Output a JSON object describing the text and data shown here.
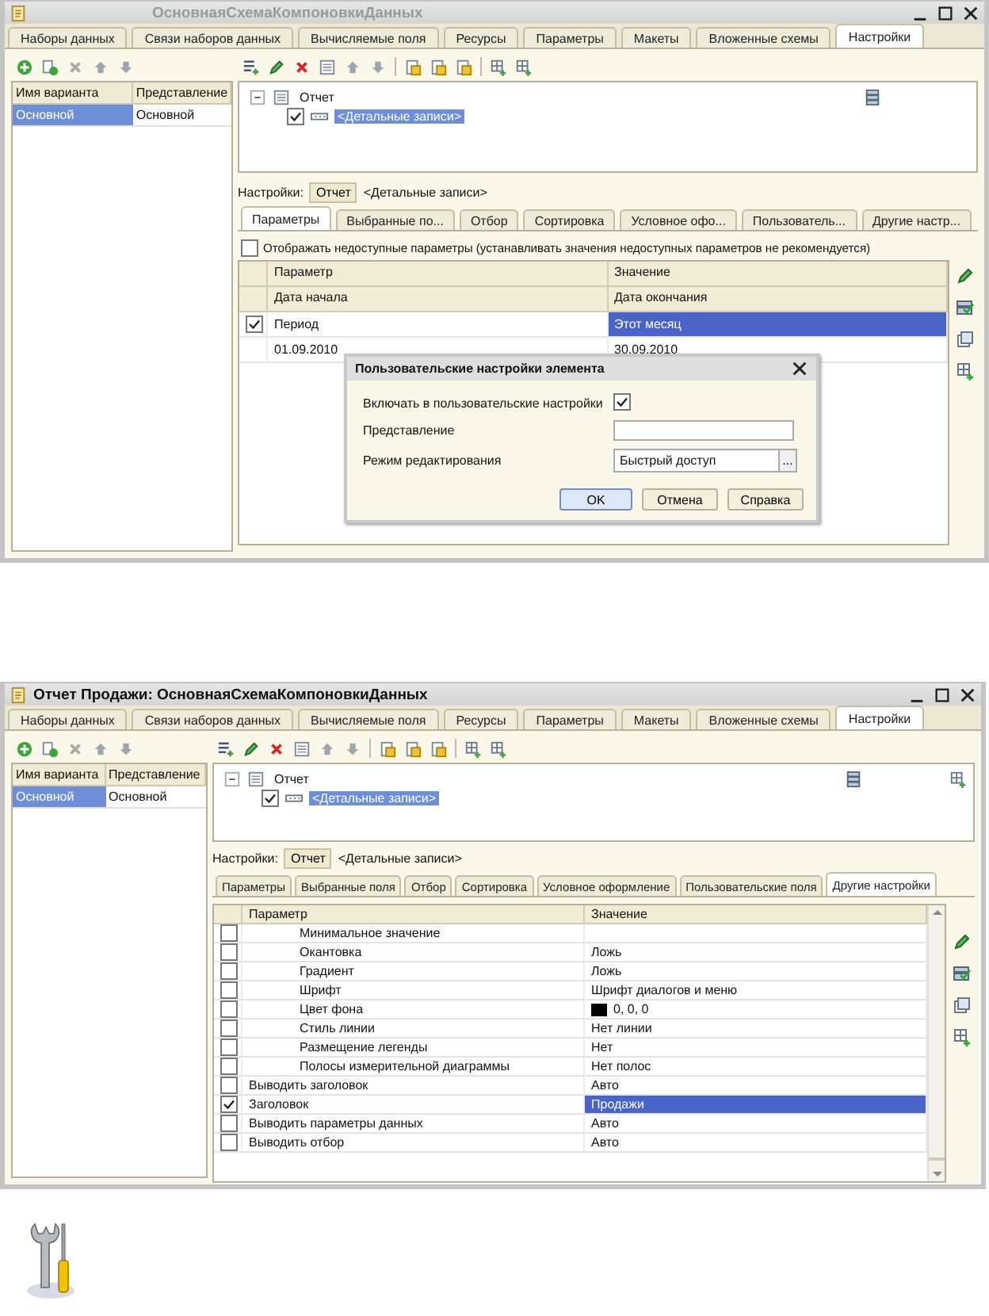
{
  "windows": [
    {
      "title": "ОсновнаяСхемаКомпоновкиДанных",
      "active": false,
      "tabs": [
        {
          "label": "Наборы данных",
          "selected": false
        },
        {
          "label": "Связи наборов данных",
          "selected": false
        },
        {
          "label": "Вычисляемые поля",
          "selected": false
        },
        {
          "label": "Ресурсы",
          "selected": false
        },
        {
          "label": "Параметры",
          "selected": false
        },
        {
          "label": "Макеты",
          "selected": false
        },
        {
          "label": "Вложенные схемы",
          "selected": false
        },
        {
          "label": "Настройки",
          "selected": true
        }
      ],
      "variants": {
        "columns": [
          "Имя варианта",
          "Представление"
        ],
        "rows": [
          {
            "cells": [
              "Основной",
              "Основной"
            ],
            "selected": true
          }
        ]
      },
      "tree": {
        "label": "Отчет",
        "expanded": true,
        "children": [
          {
            "label": "<Детальные записи>",
            "checked": true,
            "selected": true
          }
        ]
      },
      "settings": {
        "label": "Настройки:",
        "current": "Отчет",
        "path": "<Детальные записи>"
      },
      "settings_tabs": [
        {
          "label": "Параметры",
          "selected": true
        },
        {
          "label": "Выбранные по...",
          "selected": false
        },
        {
          "label": "Отбор",
          "selected": false
        },
        {
          "label": "Сортировка",
          "selected": false
        },
        {
          "label": "Условное офо...",
          "selected": false
        },
        {
          "label": "Пользователь...",
          "selected": false
        },
        {
          "label": "Другие настр...",
          "selected": false
        }
      ],
      "content": {
        "kind": "parameters",
        "option": {
          "label": "Отображать недоступные параметры (устанавливать значения недоступных параметров не рекомендуется)",
          "checked": false
        },
        "header_rows": [
          [
            "Параметр",
            "Значение"
          ],
          [
            "Дата начала",
            "Дата окончания"
          ]
        ],
        "rows": [
          {
            "checked": true,
            "selected": true,
            "cells": [
              "Период",
              "Этот месяц"
            ],
            "sub_cells": [
              "01.09.2010",
              "30.09.2010"
            ]
          }
        ],
        "dialog": {
          "title": "Пользовательские настройки элемента",
          "fields": [
            {
              "kind": "checkbox",
              "label": "Включать в пользовательские настройки",
              "checked": true
            },
            {
              "kind": "text",
              "label": "Представление"
            },
            {
              "kind": "choice",
              "label": "Режим редактирования",
              "value": "Быстрый доступ",
              "button": "..."
            }
          ],
          "buttons": [
            {
              "label": "OK",
              "default": true
            },
            {
              "label": "Отмена",
              "default": false
            },
            {
              "label": "Справка",
              "default": false
            }
          ]
        }
      }
    },
    {
      "title": "Отчет Продажи: ОсновнаяСхемаКомпоновкиДанных",
      "active": true,
      "tabs": [
        {
          "label": "Наборы данных",
          "selected": false
        },
        {
          "label": "Связи наборов данных",
          "selected": false
        },
        {
          "label": "Вычисляемые поля",
          "selected": false
        },
        {
          "label": "Ресурсы",
          "selected": false
        },
        {
          "label": "Параметры",
          "selected": false
        },
        {
          "label": "Макеты",
          "selected": false
        },
        {
          "label": "Вложенные схемы",
          "selected": false
        },
        {
          "label": "Настройки",
          "selected": true
        }
      ],
      "variants": {
        "columns": [
          "Имя варианта",
          "Представление"
        ],
        "rows": [
          {
            "cells": [
              "Основной",
              "Основной"
            ],
            "selected": true
          }
        ]
      },
      "tree": {
        "label": "Отчет",
        "expanded": true,
        "children": [
          {
            "label": "<Детальные записи>",
            "checked": true,
            "selected": true
          }
        ]
      },
      "settings": {
        "label": "Настройки:",
        "current": "Отчет",
        "path": "<Детальные записи>"
      },
      "settings_tabs": [
        {
          "label": "Параметры",
          "selected": false
        },
        {
          "label": "Выбранные поля",
          "selected": false
        },
        {
          "label": "Отбор",
          "selected": false
        },
        {
          "label": "Сортировка",
          "selected": false
        },
        {
          "label": "Условное оформление",
          "selected": false
        },
        {
          "label": "Пользовательские поля",
          "selected": false
        },
        {
          "label": "Другие настройки",
          "selected": true
        }
      ],
      "content": {
        "kind": "other_settings",
        "columns": [
          "Параметр",
          "Значение"
        ],
        "rows": [
          {
            "children": [
              {
                "checked": false,
                "selected": false,
                "parameter": "Минимальное значение"
              },
              {
                "checked": false,
                "selected": false,
                "parameter": "Окантовка",
                "value": "Ложь"
              },
              {
                "checked": false,
                "selected": false,
                "parameter": "Градиент",
                "value": "Ложь"
              },
              {
                "checked": false,
                "selected": false,
                "parameter": "Шрифт",
                "value": "Шрифт диалогов и меню"
              },
              {
                "checked": false,
                "selected": false,
                "parameter": "Цвет фона",
                "value": "0, 0, 0",
                "color": "#000000"
              },
              {
                "checked": false,
                "selected": false,
                "parameter": "Стиль линии",
                "value": "Нет линии"
              },
              {
                "checked": false,
                "selected": false,
                "parameter": "Размещение легенды",
                "value": "Нет"
              },
              {
                "checked": false,
                "selected": false,
                "parameter": "Полосы измерительной диаграммы",
                "value": "Нет полос"
              }
            ]
          },
          {
            "checked": false,
            "selected": false,
            "parameter": "Выводить заголовок",
            "value": "Авто"
          },
          {
            "checked": true,
            "selected": true,
            "parameter": "Заголовок",
            "value": "Продажи"
          },
          {
            "checked": false,
            "selected": false,
            "parameter": "Выводить параметры данных",
            "value": "Авто"
          },
          {
            "checked": false,
            "selected": false,
            "parameter": "Выводить отбор",
            "value": "Авто"
          }
        ]
      }
    }
  ]
}
